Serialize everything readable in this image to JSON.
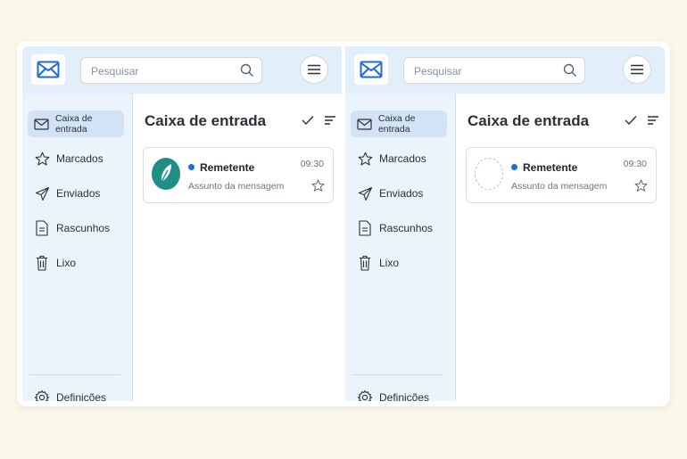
{
  "search": {
    "placeholder": "Pesquisar"
  },
  "sidebar": {
    "items": [
      {
        "label": "Caixa de entrada",
        "icon": "inbox-icon"
      },
      {
        "label": "Marcados",
        "icon": "star-icon"
      },
      {
        "label": "Enviados",
        "icon": "send-icon"
      },
      {
        "label": "Rascunhos",
        "icon": "draft-icon"
      },
      {
        "label": "Lixo",
        "icon": "trash-icon"
      }
    ],
    "settings_label": "Definições"
  },
  "main": {
    "title": "Caixa de entrada",
    "message": {
      "sender": "Remetente",
      "subject": "Assunto da mensagem",
      "time": "09:30"
    }
  },
  "colors": {
    "accent": "#1e6bd6",
    "topbar": "#e3eefb",
    "sidebar": "#ebf3fc",
    "avatar": "#1f8f85",
    "background": "#fbf8ea"
  }
}
